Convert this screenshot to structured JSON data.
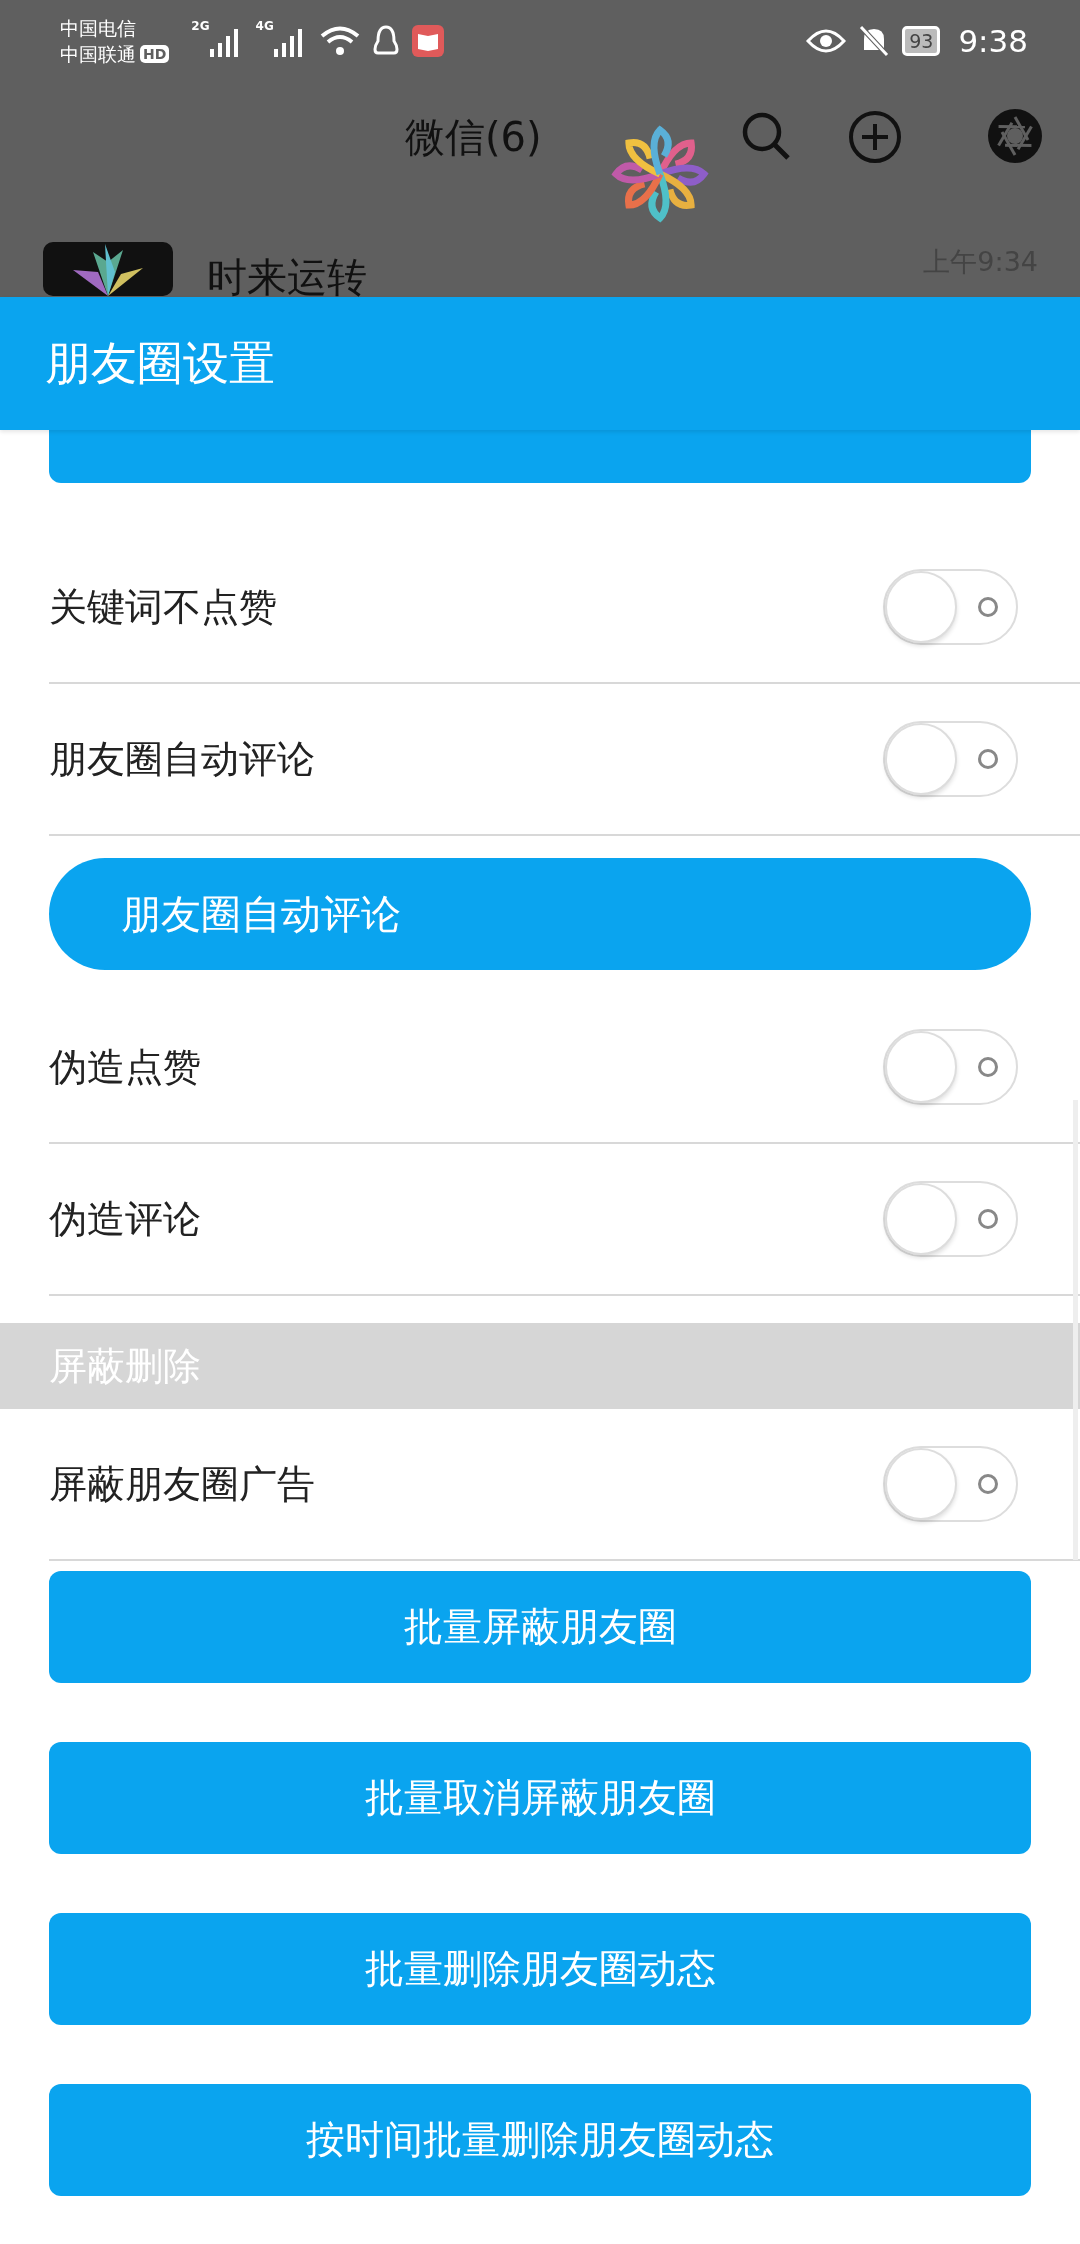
{
  "status_bar": {
    "carriers": [
      "中国电信",
      "中国联通"
    ],
    "hd_badge": "HD",
    "networks": [
      "2G",
      "4G"
    ],
    "battery": "93",
    "time": "9:38"
  },
  "background_app": {
    "title": "微信(6)",
    "chat": {
      "name": "时来运转",
      "time": "上午9:34"
    }
  },
  "header": {
    "title": "朋友圈设置"
  },
  "items": [
    {
      "kind": "partial_button"
    },
    {
      "kind": "toggle",
      "label": "关键词不点赞",
      "on": false
    },
    {
      "kind": "toggle",
      "label": "朋友圈自动评论",
      "on": false
    },
    {
      "kind": "pill_button",
      "label": "朋友圈自动评论"
    },
    {
      "kind": "toggle",
      "label": "伪造点赞",
      "on": false
    },
    {
      "kind": "toggle",
      "label": "伪造评论",
      "on": false
    },
    {
      "kind": "section",
      "label": "屏蔽删除"
    },
    {
      "kind": "toggle",
      "label": "屏蔽朋友圈广告",
      "on": false
    },
    {
      "kind": "button",
      "label": "批量屏蔽朋友圈"
    },
    {
      "kind": "button",
      "label": "批量取消屏蔽朋友圈"
    },
    {
      "kind": "button",
      "label": "批量删除朋友圈动态"
    },
    {
      "kind": "button",
      "label": "按时间批量删除朋友圈动态"
    }
  ]
}
